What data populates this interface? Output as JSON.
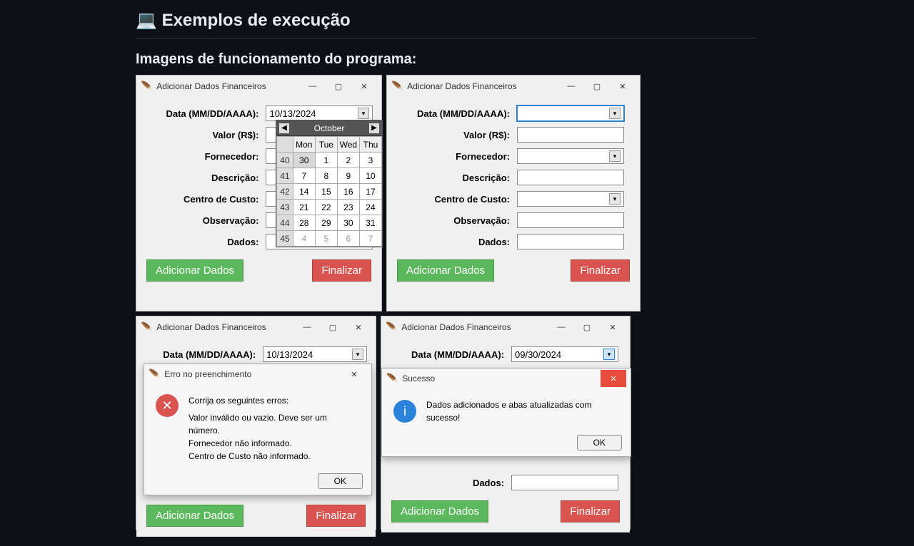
{
  "page": {
    "heading_icon": "💻",
    "heading": "Exemplos de execução",
    "subheading": "Imagens de funcionamento do programa:"
  },
  "labels": {
    "data": "Data (MM/DD/AAAA):",
    "valor": "Valor (R$):",
    "fornecedor": "Fornecedor:",
    "descricao": "Descrição:",
    "centro": "Centro de Custo:",
    "observacao": "Observação:",
    "dados": "Dados:",
    "add_btn": "Adicionar Dados",
    "fin_btn": "Finalizar"
  },
  "window_title": "Adicionar Dados Financeiros",
  "calendar": {
    "month": "October",
    "weekdays": [
      "Mon",
      "Tue",
      "Wed",
      "Thu"
    ],
    "rows": [
      {
        "wk": "40",
        "days": [
          "30",
          "1",
          "2",
          "3"
        ]
      },
      {
        "wk": "41",
        "days": [
          "7",
          "8",
          "9",
          "10"
        ]
      },
      {
        "wk": "42",
        "days": [
          "14",
          "15",
          "16",
          "17"
        ]
      },
      {
        "wk": "43",
        "days": [
          "21",
          "22",
          "23",
          "24"
        ]
      },
      {
        "wk": "44",
        "days": [
          "28",
          "29",
          "30",
          "31"
        ]
      },
      {
        "wk": "45",
        "days": [
          "4",
          "5",
          "6",
          "7"
        ]
      }
    ]
  },
  "win1": {
    "date_value": "10/13/2024"
  },
  "win2": {
    "date_value": ""
  },
  "win3": {
    "date_value": "10/13/2024"
  },
  "win4": {
    "date_value": "09/30/2024"
  },
  "error_dialog": {
    "title": "Erro no preenchimento",
    "heading": "Corrija os seguintes erros:",
    "line1": "Valor inválido ou vazio. Deve ser um número.",
    "line2": "Fornecedor não informado.",
    "line3": "Centro de Custo não informado.",
    "ok": "OK"
  },
  "success_dialog": {
    "title": "Sucesso",
    "text": "Dados adicionados e abas atualizadas com sucesso!",
    "ok": "OK"
  }
}
